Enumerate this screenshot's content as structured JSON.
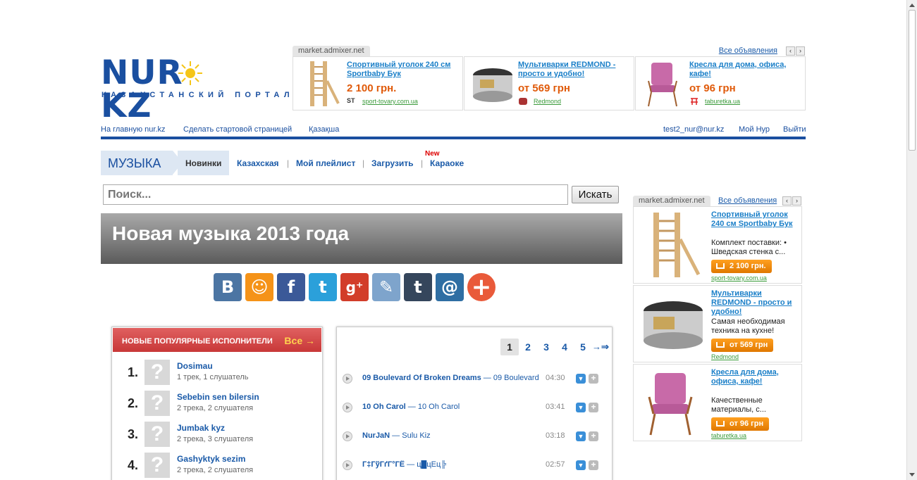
{
  "logo": {
    "wordmark_left": "NUR",
    "wordmark_right": "KZ",
    "tagline": "КАЗАХСТАНСКИЙ ПОРТАЛ"
  },
  "top_ad": {
    "source": "market.admixer.net",
    "all_label": "Все объявления",
    "prev": "‹",
    "next": "›",
    "items": [
      {
        "title": "Спортивный уголок 240 см Sportbaby Бук",
        "price": "2 100 грн.",
        "shop_badge": "ST",
        "shop": "sport-tovary.com.ua"
      },
      {
        "title": "Мультиварки REDMOND - просто и удобно!",
        "price": "от 569 грн",
        "shop_badge": "",
        "shop": "Redmond"
      },
      {
        "title": "Кресла для дома, офиса, кафе!",
        "price": "от 96 грн",
        "shop_badge": "",
        "shop": "taburetka.ua"
      }
    ]
  },
  "topnav": {
    "home": "На главную nur.kz",
    "start": "Сделать стартовой страницей",
    "kazakh": "Қазақша",
    "email": "test2_nur@nur.kz",
    "my": "Мой Нур",
    "logout": "Выйти"
  },
  "secnav": {
    "section": "МУЗЫКА",
    "active": "Новинки",
    "links": [
      "Казахская",
      "Мой плейлист",
      "Загрузить",
      "Караоке"
    ],
    "sep": "|",
    "new_badge": "New"
  },
  "search": {
    "placeholder": "Поиск...",
    "button": "Искать"
  },
  "banner": {
    "title": "Новая музыка 2013 года"
  },
  "share": {
    "vk": "В",
    "ok": "☺",
    "fb": "f",
    "tw": "t",
    "gplus": "g⁺",
    "lj": "✎",
    "tumblr": "t",
    "mail": "@",
    "more": "+"
  },
  "artists": {
    "header": "НОВЫЕ ПОПУЛЯРНЫЕ ИСПОЛНИТЕЛИ",
    "all": "Все →",
    "placeholder_glyph": "?",
    "items": [
      {
        "num": "1.",
        "name": "Dosimau",
        "count": "1 трек, 1 слушатель"
      },
      {
        "num": "2.",
        "name": "Sebebin sen bilersin",
        "count": "2 трека, 2 слушателя"
      },
      {
        "num": "3.",
        "name": "Jumbak kyz",
        "count": "2 трека, 3 слушателя"
      },
      {
        "num": "4.",
        "name": "Gashyktyk sezim",
        "count": "2 трека, 2 слушателя"
      }
    ]
  },
  "tracks": {
    "pages": [
      "1",
      "2",
      "3",
      "4",
      "5"
    ],
    "next": "→⇒",
    "items": [
      {
        "artist": "09 Boulevard Of Broken Dreams",
        "sep": " — ",
        "title": "09 Boulevard",
        "duration": "04:30"
      },
      {
        "artist": "10 Oh Carol",
        "sep": " — ",
        "title": "10 Oh Carol",
        "duration": "03:41"
      },
      {
        "artist": "NurJaN",
        "sep": " — ",
        "title": "Sulu Kiz",
        "duration": "03:18"
      },
      {
        "artist": "Г‡ГўГґГ°ГЁ",
        "sep": " — ",
        "title": "ц█цЕц╠",
        "duration": "02:57"
      }
    ]
  },
  "right_ad": {
    "source": "market.admixer.net",
    "all_label": "Все объявления",
    "prev": "‹",
    "next": "›",
    "items": [
      {
        "title": "Спортивный уголок 240 см Sportbaby Бук",
        "desc": "Комплект поставки: • Шведская стенка с...",
        "price": "2 100 грн.",
        "shop": "sport-tovary.com.ua"
      },
      {
        "title": "Мультиварки REDMOND - просто и удобно!",
        "desc": "Самая необходимая техника на кухне!",
        "price": "от 569 грн",
        "shop": "Redmond"
      },
      {
        "title": "Кресла для дома, офиса, кафе!",
        "desc": "Качественные материалы, с...",
        "price": "от 96 грн",
        "shop": "taburetka.ua"
      }
    ]
  },
  "colors": {
    "brand_blue": "#1a4fa0",
    "link": "#1a5aa8",
    "price_orange": "#e05a0a",
    "artist_header_red": "#c83838"
  }
}
